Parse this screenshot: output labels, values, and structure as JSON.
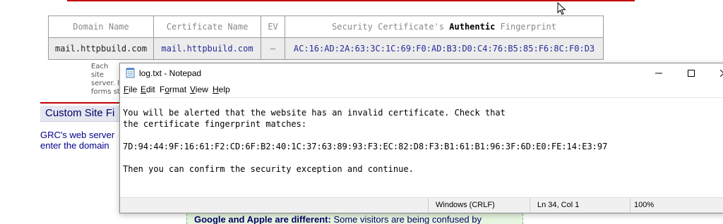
{
  "web": {
    "table": {
      "headers": {
        "domain": "Domain Name",
        "certificate": "Certificate Name",
        "ev": "EV",
        "fingerprint_pre": "Security Certificate's",
        "fingerprint_bold": "Authentic",
        "fingerprint_post": "Fingerprint"
      },
      "row": {
        "domain": "mail.httpbuild.com",
        "certificate": "mail.httpbuild.com",
        "ev": "—",
        "fingerprint": "AC:16:AD:2A:63:3C:1C:69:F0:AD:B3:D0:C4:76:B5:85:F6:8C:F0:D3"
      }
    },
    "note_lines": [
      "Each site",
      "server. I",
      "forms st"
    ],
    "section_title": "Custom Site Fi",
    "grc_lines": [
      "GRC's web server",
      "enter the domain"
    ],
    "green_box": {
      "bold": "Google and Apple are different:",
      "rest": " Some visitors are being confused by"
    }
  },
  "notepad": {
    "title": "log.txt - Notepad",
    "menu": {
      "file_u": "F",
      "file_rest": "ile",
      "edit_u": "E",
      "edit_rest": "dit",
      "format_pre": "F",
      "format_u": "o",
      "format_rest": "rmat",
      "view_u": "V",
      "view_rest": "iew",
      "help_u": "H",
      "help_rest": "elp"
    },
    "lines": [
      "You will be alerted that the website has an invalid certificate. Check that",
      "the certificate fingerprint matches:",
      "",
      "7D:94:44:9F:16:61:F2:CD:6F:B2:40:1C:37:63:89:93:F3:EC:82:D8:F3:B1:61:B1:96:3F:6D:E0:FE:14:E3:97",
      "",
      "Then you can confirm the security exception and continue."
    ],
    "status": {
      "line_endings": "Windows (CRLF)",
      "position": "Ln 34, Col 1",
      "zoom": "100%"
    }
  }
}
